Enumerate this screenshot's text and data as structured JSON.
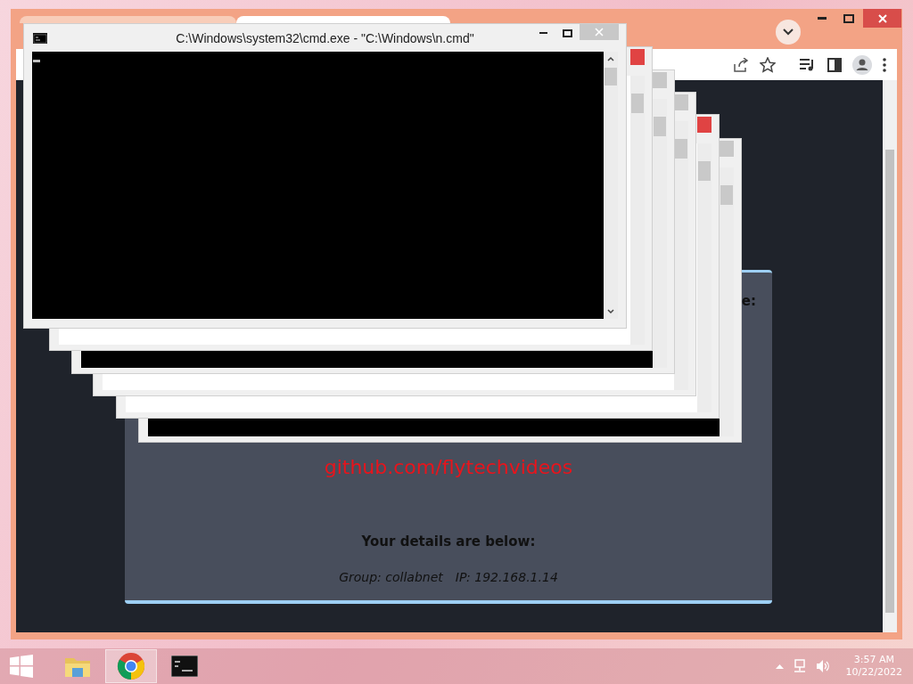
{
  "browser": {
    "page": {
      "fragment": "e:",
      "link": "github.com/flytechvideos",
      "details_heading": "Your details are below:",
      "group": "Group: collabnet",
      "ip": "IP: 192.168.1.14"
    }
  },
  "console": {
    "title": "C:\\Windows\\system32\\cmd.exe - \"C:\\Windows\\n.cmd\""
  },
  "taskbar": {
    "apps": [
      {
        "kind": "folder",
        "selected": false
      },
      {
        "kind": "browser",
        "selected": true
      },
      {
        "kind": "terminal",
        "selected": false
      }
    ],
    "time": "3:57 AM",
    "date": "10/22/2022"
  }
}
